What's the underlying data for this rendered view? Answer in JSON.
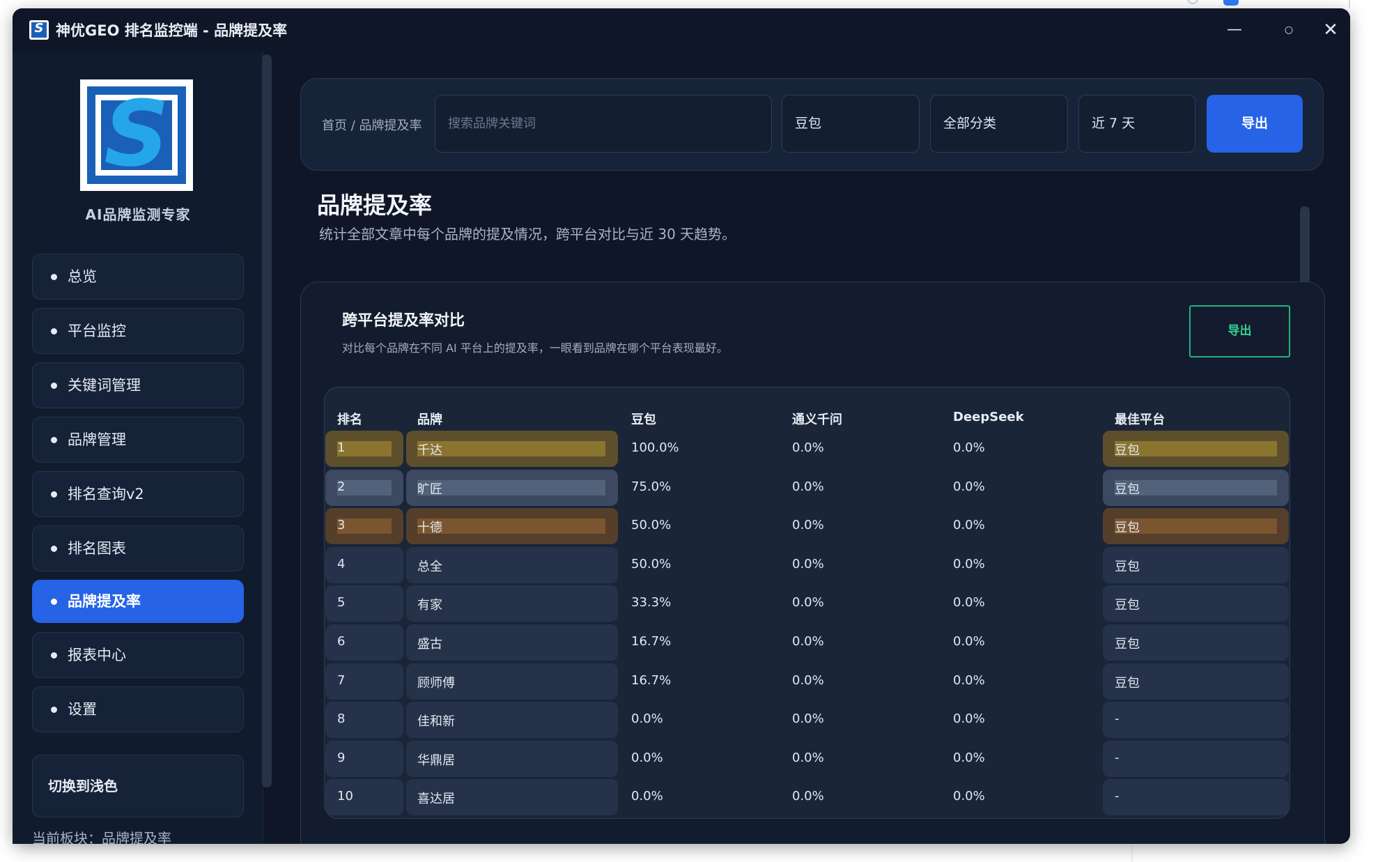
{
  "window": {
    "title": "神优GEO 排名监控端 - 品牌提及率",
    "controls": {
      "minimize": "—",
      "maximize": "○",
      "close": "✕"
    }
  },
  "sidebar": {
    "logo_caption": "AI品牌监测专家",
    "nav_items": [
      {
        "label": "总览",
        "active": false
      },
      {
        "label": "平台监控",
        "active": false
      },
      {
        "label": "关键词管理",
        "active": false
      },
      {
        "label": "品牌管理",
        "active": false
      },
      {
        "label": "排名查询v2",
        "active": false
      },
      {
        "label": "排名图表",
        "active": false
      },
      {
        "label": "品牌提及率",
        "active": true
      },
      {
        "label": "报表中心",
        "active": false
      },
      {
        "label": "设置",
        "active": false
      }
    ],
    "theme_toggle": "切换到浅色",
    "current_section": "当前板块：品牌提及率"
  },
  "toolbar": {
    "breadcrumb": "首页 / 品牌提及率",
    "search_placeholder": "搜索品牌关键词",
    "platform": "豆包",
    "category": "全部分类",
    "range": "近 7 天",
    "export": "导出"
  },
  "page": {
    "title": "品牌提及率",
    "description": "统计全部文章中每个品牌的提及情况，跨平台对比与近 30 天趋势。"
  },
  "card": {
    "title": "跨平台提及率对比",
    "description": "对比每个品牌在不同 AI 平台上的提及率，一眼看到品牌在哪个平台表现最好。",
    "export": "导出"
  },
  "table": {
    "headers": [
      "排名",
      "品牌",
      "豆包",
      "通义千问",
      "DeepSeek",
      "最佳平台"
    ],
    "rows": [
      {
        "rank": "1",
        "brand": "千达",
        "doubao": "100.0%",
        "qwen": "0.0%",
        "deepseek": "0.0%",
        "best": "豆包",
        "tier": "gold"
      },
      {
        "rank": "2",
        "brand": "旷匠",
        "doubao": "75.0%",
        "qwen": "0.0%",
        "deepseek": "0.0%",
        "best": "豆包",
        "tier": "silver"
      },
      {
        "rank": "3",
        "brand": "十德",
        "doubao": "50.0%",
        "qwen": "0.0%",
        "deepseek": "0.0%",
        "best": "豆包",
        "tier": "bronze"
      },
      {
        "rank": "4",
        "brand": "总全",
        "doubao": "50.0%",
        "qwen": "0.0%",
        "deepseek": "0.0%",
        "best": "豆包",
        "tier": ""
      },
      {
        "rank": "5",
        "brand": "有家",
        "doubao": "33.3%",
        "qwen": "0.0%",
        "deepseek": "0.0%",
        "best": "豆包",
        "tier": ""
      },
      {
        "rank": "6",
        "brand": "盛古",
        "doubao": "16.7%",
        "qwen": "0.0%",
        "deepseek": "0.0%",
        "best": "豆包",
        "tier": ""
      },
      {
        "rank": "7",
        "brand": "顾师傅",
        "doubao": "16.7%",
        "qwen": "0.0%",
        "deepseek": "0.0%",
        "best": "豆包",
        "tier": ""
      },
      {
        "rank": "8",
        "brand": "佳和新",
        "doubao": "0.0%",
        "qwen": "0.0%",
        "deepseek": "0.0%",
        "best": "-",
        "tier": ""
      },
      {
        "rank": "9",
        "brand": "华鼎居",
        "doubao": "0.0%",
        "qwen": "0.0%",
        "deepseek": "0.0%",
        "best": "-",
        "tier": ""
      },
      {
        "rank": "10",
        "brand": "喜达居",
        "doubao": "0.0%",
        "qwen": "0.0%",
        "deepseek": "0.0%",
        "best": "-",
        "tier": ""
      }
    ]
  },
  "colors": {
    "accent": "#2663e6",
    "export_green": "#35d08f",
    "background": "#0e1627"
  }
}
